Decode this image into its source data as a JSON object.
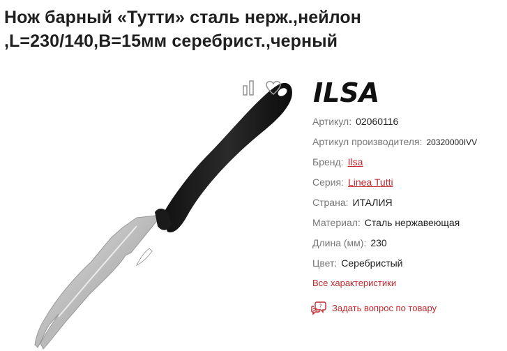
{
  "product": {
    "title": "Нож барный «Тутти» сталь нерж.,нейлон ,L=230/140,B=15мм серебрист.,черный",
    "brand_logo_text": "ILSA"
  },
  "specs": {
    "article": {
      "label": "Артикул:",
      "value": "02060116"
    },
    "manufacturer_article": {
      "label": "Артикул производителя:",
      "value": "20320000IVV"
    },
    "brand": {
      "label": "Бренд:",
      "value": "Ilsa"
    },
    "series": {
      "label": "Серия:",
      "value": "Linea Tutti"
    },
    "country": {
      "label": "Страна:",
      "value": "ИТАЛИЯ"
    },
    "material": {
      "label": "Материал:",
      "value": "Сталь нержавеющая"
    },
    "length": {
      "label": "Длина (мм):",
      "value": "230"
    },
    "color": {
      "label": "Цвет:",
      "value": "Серебристый"
    }
  },
  "links": {
    "all_specs": "Все характеристики",
    "ask_question": "Задать вопрос по товару"
  },
  "icons": {
    "compare": "compare-icon",
    "favorite": "heart-icon",
    "ask": "question-chat-icon"
  },
  "colors": {
    "accent": "#c0282d",
    "label": "#777777",
    "text": "#222222"
  }
}
